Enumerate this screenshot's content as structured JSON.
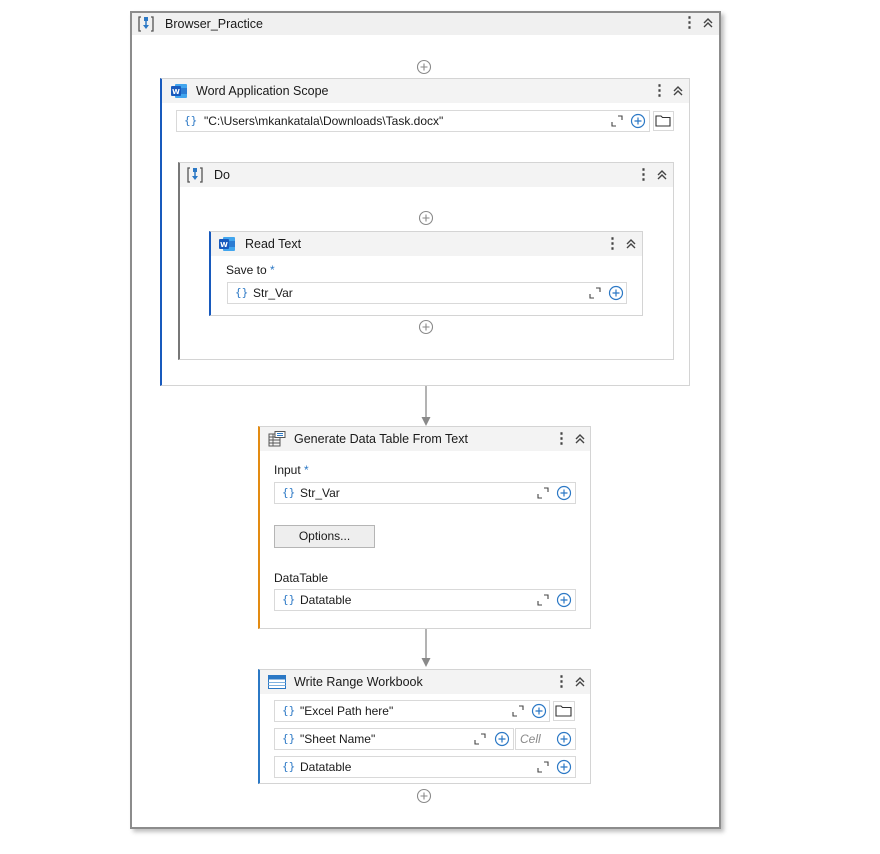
{
  "root": {
    "title": "Browser_Practice"
  },
  "word_scope": {
    "title": "Word Application Scope",
    "path_value": "\"C:\\Users\\mkankatala\\Downloads\\Task.docx\""
  },
  "do_block": {
    "title": "Do"
  },
  "read_text": {
    "title": "Read Text",
    "save_to_label": "Save to",
    "save_to_value": "Str_Var",
    "required_mark": "*"
  },
  "gen_table": {
    "title": "Generate Data Table From Text",
    "input_label": "Input",
    "required_mark": "*",
    "input_value": "Str_Var",
    "options_label": "Options...",
    "datatable_label": "DataTable",
    "datatable_value": "Datatable"
  },
  "write_range": {
    "title": "Write Range Workbook",
    "excel_path": "\"Excel Path here\"",
    "sheet_name": "\"Sheet Name\"",
    "cell_placeholder": "Cell",
    "datatable_value": "Datatable"
  },
  "icons": {
    "sequence": "sequence-icon",
    "word": "word-icon",
    "datatable": "datatable-icon",
    "excel": "excel-range-icon",
    "kebab": "kebab-menu-icon",
    "collapse": "collapse-icon",
    "expand": "expand-icon",
    "add": "add-circle-icon",
    "folder": "folder-icon"
  },
  "colors": {
    "accent_blue": "#2b78c5",
    "word_blue": "#185abd",
    "orange_accent": "#e38b12",
    "header_bg": "#f3f3f3"
  }
}
